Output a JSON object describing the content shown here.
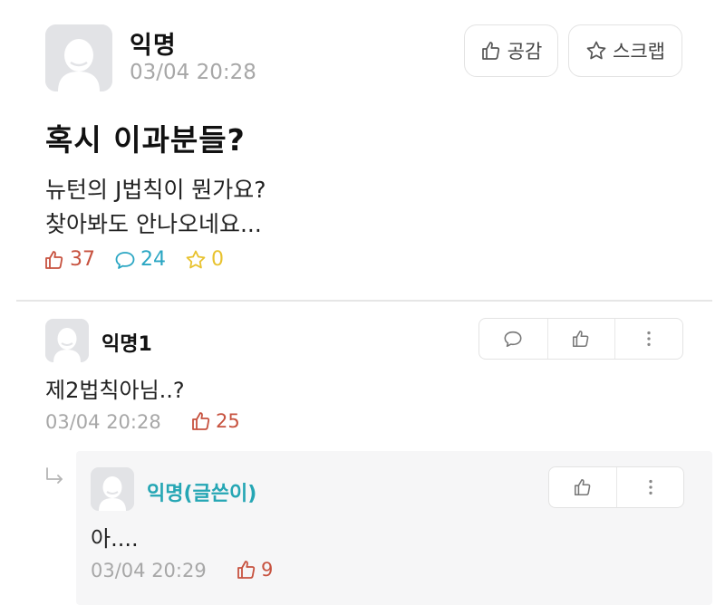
{
  "post": {
    "author": "익명",
    "time": "03/04 20:28",
    "like_button_label": "공감",
    "scrap_button_label": "스크랩",
    "title": "혹시 이과분들?",
    "body_lines": [
      "뉴턴의 J법칙이 뭔가요?",
      "찾아봐도 안나오네요..."
    ],
    "stats": {
      "likes": "37",
      "comments": "24",
      "scraps": "0"
    }
  },
  "comments": [
    {
      "author": "익명1",
      "text": "제2법칙아님..?",
      "time": "03/04 20:28",
      "likes": "25",
      "replies": [
        {
          "author": "익명(글쓴이)",
          "text": "아....",
          "time": "03/04 20:29",
          "likes": "9"
        }
      ]
    }
  ],
  "icons": {
    "like": "thumbs-up-icon",
    "scrap": "star-icon",
    "comment": "speech-bubble-icon",
    "more": "more-vertical-icon",
    "reply": "reply-arrow-icon",
    "avatar": "default-avatar-icon"
  },
  "colors": {
    "like_count": "#c7523f",
    "comment_count": "#2aa6c3",
    "scrap_count": "#e8c22e",
    "op_author": "#25a6b4",
    "timestamp": "#a7a7a7"
  }
}
